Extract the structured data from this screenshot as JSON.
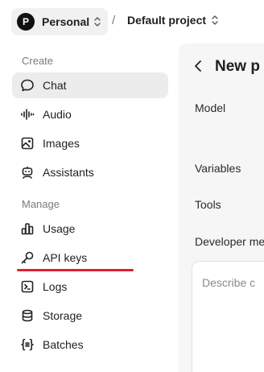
{
  "header": {
    "avatar_letter": "P",
    "org_name": "Personal",
    "separator": "/",
    "project_name": "Default project"
  },
  "sidebar": {
    "sections": {
      "create": "Create",
      "manage": "Manage"
    },
    "items": [
      {
        "label": "Chat",
        "icon": "chat-bubble-icon",
        "active": true
      },
      {
        "label": "Audio",
        "icon": "waveform-icon"
      },
      {
        "label": "Images",
        "icon": "image-icon"
      },
      {
        "label": "Assistants",
        "icon": "robot-icon"
      },
      {
        "label": "Usage",
        "icon": "bar-chart-icon"
      },
      {
        "label": "API keys",
        "icon": "key-icon"
      },
      {
        "label": "Logs",
        "icon": "terminal-icon"
      },
      {
        "label": "Storage",
        "icon": "database-icon"
      },
      {
        "label": "Batches",
        "icon": "braces-icon"
      }
    ]
  },
  "main": {
    "title": "New p",
    "fields": {
      "model": "Model",
      "variables": "Variables",
      "tools": "Tools",
      "developer": "Developer me"
    },
    "developer_placeholder": "Describe c"
  },
  "colors": {
    "active_bg": "#ececec",
    "underline": "#e0202e",
    "panel_bg": "#f6f6f6"
  }
}
